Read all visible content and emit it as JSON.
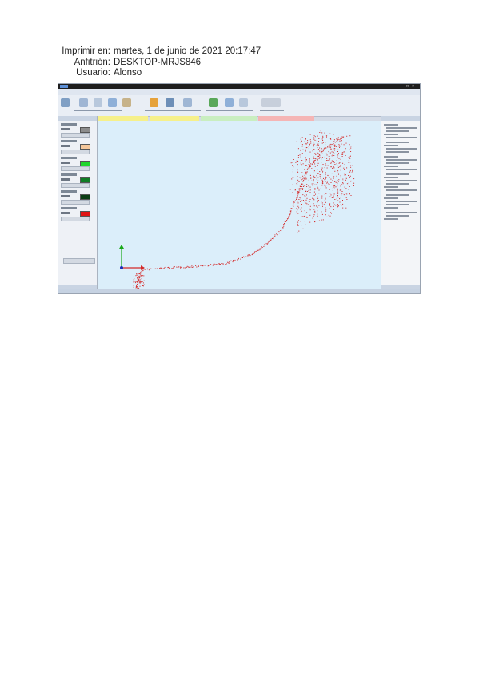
{
  "print_header": {
    "print_label": "Imprimir en:",
    "print_value": "martes, 1 de junio de 2021 20:17:47",
    "host_label": "Anfitrión:",
    "host_value": "DESKTOP-MRJS846",
    "user_label": "Usuario:",
    "user_value": "Alonso"
  },
  "screenshot": {
    "colors": {
      "canvas_bg": "#dbeefa",
      "trace": "#d42828",
      "axis_x": "#d42828",
      "axis_y": "#18a818",
      "axis_origin": "#1a2fb8",
      "swatch_1": "#8c8c8c",
      "swatch_2": "#f4c69a",
      "swatch_3": "#1fd62c",
      "swatch_4": "#0f7d24",
      "swatch_5": "#0b3d14",
      "swatch_6": "#e01414"
    },
    "document_tabs": [
      {
        "color": "#f6f08a"
      },
      {
        "color": "#f6f08a"
      },
      {
        "color": "#c9eec0"
      },
      {
        "color": "#f5b5b5"
      }
    ]
  }
}
